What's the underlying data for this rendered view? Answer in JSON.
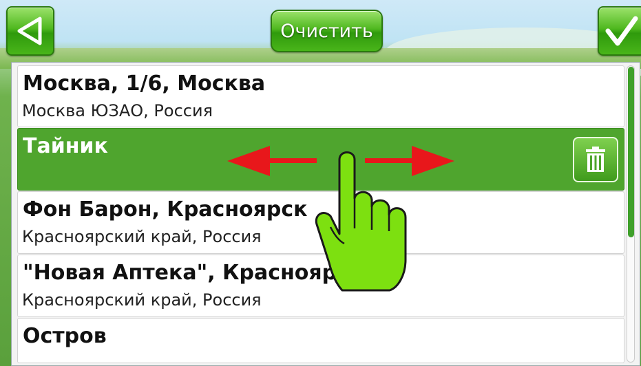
{
  "header": {
    "clear_label": "Очистить"
  },
  "icons": {
    "back": "back-arrow-icon",
    "ok": "checkmark-icon",
    "delete": "trash-icon",
    "gesture": "swipe-hand-icon"
  },
  "colors": {
    "accent": "#4fa52e",
    "swipe_arrow": "#e8171b",
    "hand": "#7de010"
  },
  "list": {
    "items": [
      {
        "title": "Москва, 1/6, Москва",
        "subtitle": "Москва ЮЗАО, Россия"
      },
      {
        "title": "Тайник",
        "subtitle": ""
      },
      {
        "title": "Фон Барон, Красноярск",
        "subtitle": "Красноярский край, Россия"
      },
      {
        "title": "\"Новая Аптека\", Красноярск",
        "subtitle": "Красноярский край, Россия"
      },
      {
        "title": "Остров",
        "subtitle": ""
      }
    ]
  }
}
